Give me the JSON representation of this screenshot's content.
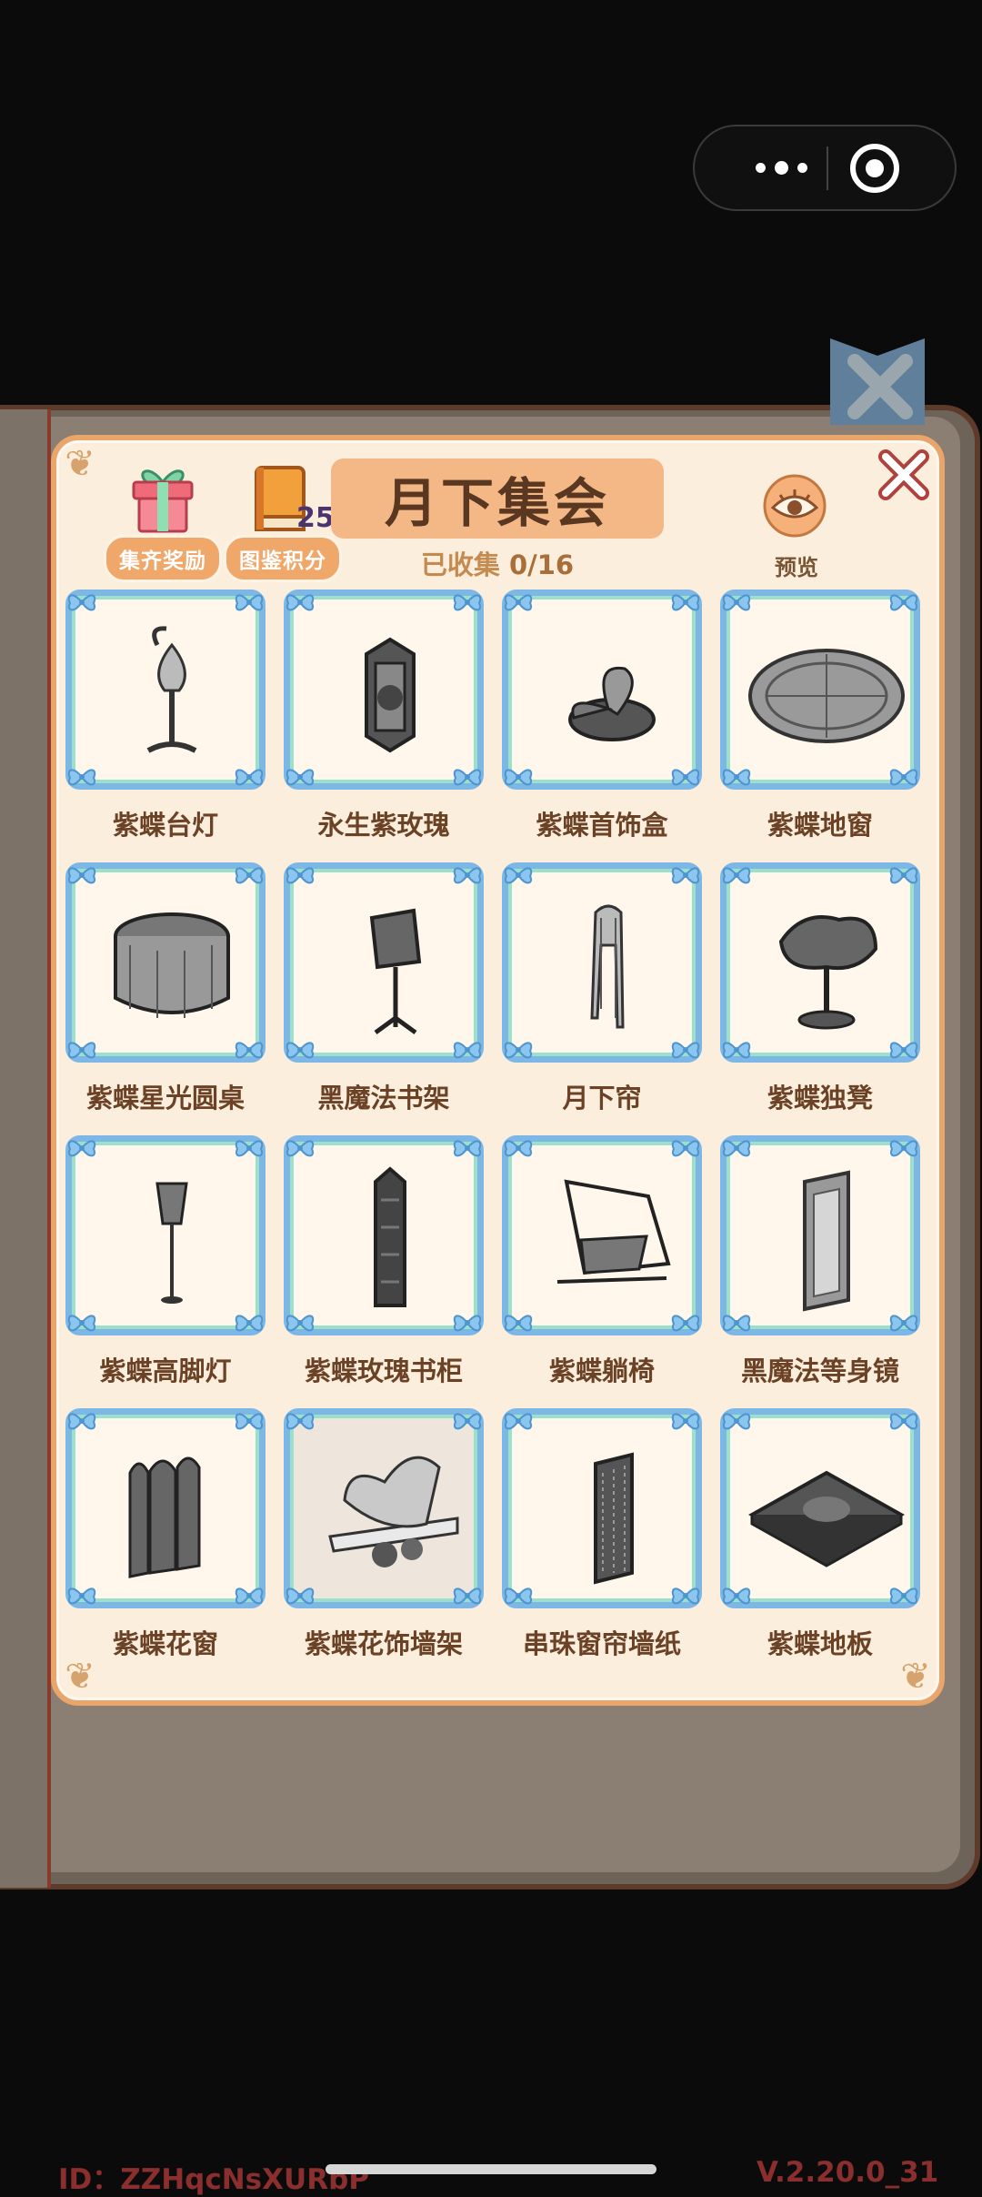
{
  "header": {
    "title": "月下集会",
    "collected_label": "已收集",
    "collected_value": "0/16",
    "reward_button": "集齐奖励",
    "points_button": "图鉴积分",
    "points_value": "25",
    "preview_label": "预览"
  },
  "items": [
    {
      "name": "紫蝶台灯",
      "icon": "lamp-icon"
    },
    {
      "name": "永生紫玫瑰",
      "icon": "rose-lantern-icon"
    },
    {
      "name": "紫蝶首饰盒",
      "icon": "jewelry-box-icon"
    },
    {
      "name": "紫蝶地窗",
      "icon": "floor-window-icon"
    },
    {
      "name": "紫蝶星光圆桌",
      "icon": "round-table-icon"
    },
    {
      "name": "黑魔法书架",
      "icon": "book-stand-icon"
    },
    {
      "name": "月下帘",
      "icon": "curtain-icon"
    },
    {
      "name": "紫蝶独凳",
      "icon": "stool-icon"
    },
    {
      "name": "紫蝶高脚灯",
      "icon": "floor-lamp-icon"
    },
    {
      "name": "紫蝶玫瑰书柜",
      "icon": "bookcase-icon"
    },
    {
      "name": "紫蝶躺椅",
      "icon": "swing-chair-icon"
    },
    {
      "name": "黑魔法等身镜",
      "icon": "mirror-icon"
    },
    {
      "name": "紫蝶花窗",
      "icon": "screen-window-icon"
    },
    {
      "name": "紫蝶花饰墙架",
      "icon": "wall-shelf-icon"
    },
    {
      "name": "串珠窗帘墙纸",
      "icon": "bead-wallpaper-icon"
    },
    {
      "name": "紫蝶地板",
      "icon": "floor-tile-icon"
    }
  ],
  "footer": {
    "id_text": "ID：ZZHqcNsXURbP",
    "version": "V.2.20.0_31"
  }
}
